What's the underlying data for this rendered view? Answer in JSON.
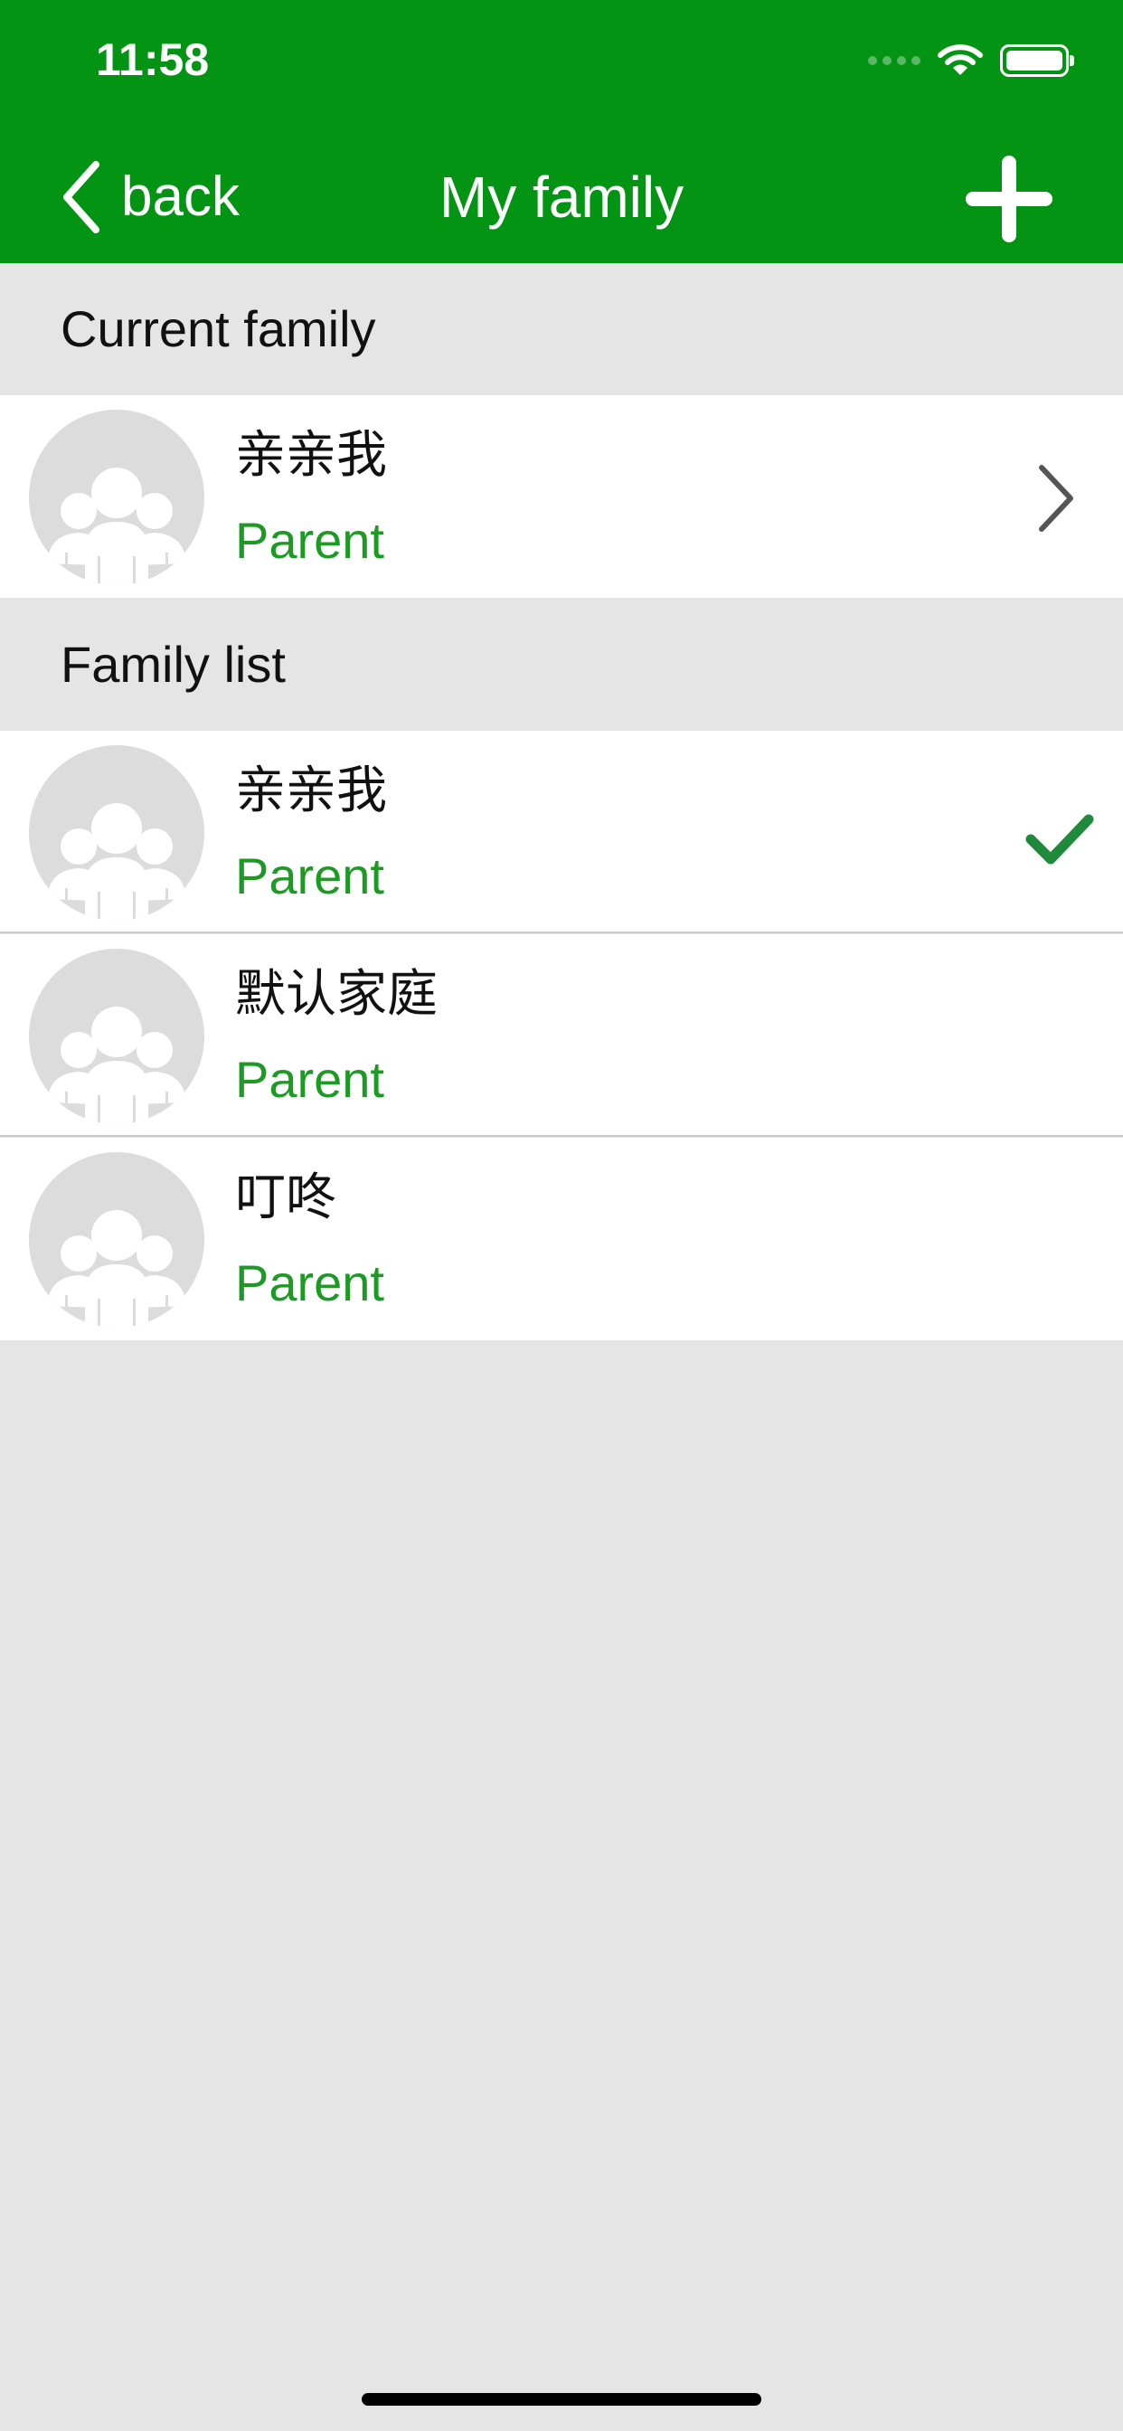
{
  "status_bar": {
    "time": "11:58"
  },
  "nav": {
    "back_label": "back",
    "title": "My family"
  },
  "sections": {
    "current": {
      "header": "Current family",
      "item": {
        "name": "亲亲我",
        "role": "Parent"
      }
    },
    "list": {
      "header": "Family list",
      "items": [
        {
          "name": "亲亲我",
          "role": "Parent",
          "selected": true
        },
        {
          "name": "默认家庭",
          "role": "Parent",
          "selected": false
        },
        {
          "name": "叮咚",
          "role": "Parent",
          "selected": false
        }
      ]
    }
  },
  "icons": {
    "back": "chevron-left-icon",
    "add": "plus-icon",
    "avatar": "family-group-icon",
    "disclosure": "chevron-right-icon",
    "selected": "checkmark-icon"
  },
  "colors": {
    "header_bg": "#039414",
    "role_text": "#1c9a24",
    "check": "#1f8a3a",
    "background": "#e5e5e5"
  }
}
